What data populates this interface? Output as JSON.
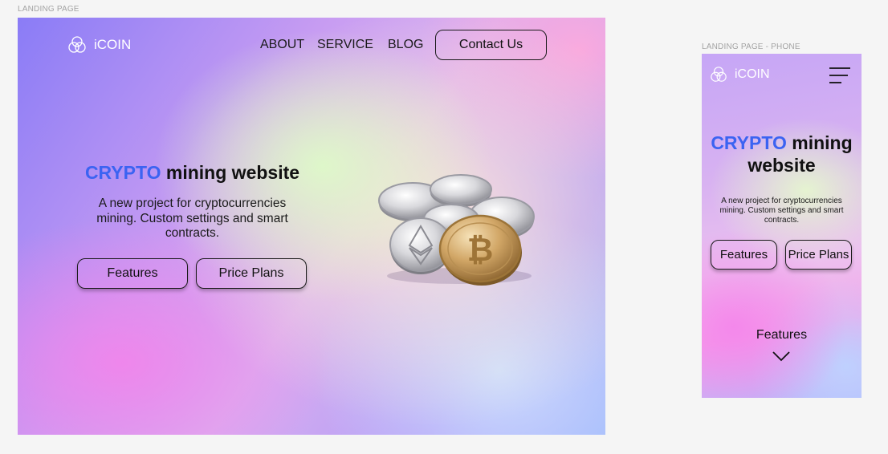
{
  "labels": {
    "desktop": "LANDING PAGE",
    "phone": "LANDING PAGE - PHONE"
  },
  "desktop": {
    "logo_text": "iCOIN",
    "nav": {
      "about": "ABOUT",
      "service": "SERVICE",
      "blog": "BLOG",
      "contact": "Contact Us"
    },
    "hero": {
      "title_accent": "CRYPTO",
      "title_rest": "mining website",
      "subtitle": "A new project for cryptocurrencies mining. Custom settings and smart contracts.",
      "features_button": "Features",
      "price_button": "Price Plans"
    }
  },
  "phone": {
    "logo_text": "iCOIN",
    "hero": {
      "title_accent": "CRYPTO",
      "title_rest": "mining website",
      "subtitle": "A new project for cryptocurrencies mining. Custom settings and smart contracts.",
      "features_button": "Features",
      "price_button": "Price Plans"
    },
    "scroll_label": "Features"
  },
  "colors": {
    "accent": "#3b63f2",
    "text": "#111111",
    "canvas": "#f5f5f5"
  },
  "icons": [
    "logo-rings-icon",
    "hamburger-menu-icon",
    "chevron-down-icon",
    "crypto-coins-image"
  ]
}
